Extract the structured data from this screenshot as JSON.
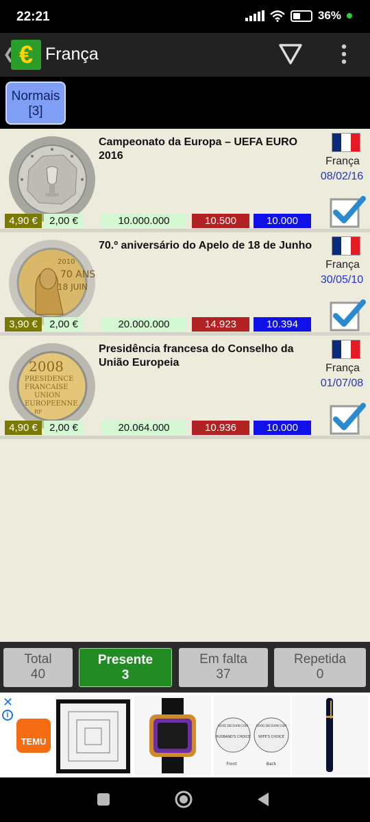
{
  "status": {
    "time": "22:21",
    "battery": "36%"
  },
  "appbar": {
    "title": "França",
    "logo_symbol": "€",
    "back_icon": "chevron-left-icon"
  },
  "tabs": [
    {
      "label": "Normais",
      "count": "[3]"
    }
  ],
  "coins": [
    {
      "title": "Campeonato da Europa – UEFA EURO 2016",
      "country": "França",
      "date": "08/02/16",
      "value": "4,90 €",
      "face": "2,00 €",
      "mintage": "10.000.000",
      "stat_red": "10.500",
      "stat_blue": "10.000",
      "checked": true
    },
    {
      "title": "70.º aniversário do Apelo de 18 de Junho",
      "country": "França",
      "date": "30/05/10",
      "value": "3,90 €",
      "face": "2,00 €",
      "mintage": "20.000.000",
      "stat_red": "14.923",
      "stat_blue": "10.394",
      "checked": true
    },
    {
      "title": "Presidência francesa do Conselho da União Europeia",
      "country": "França",
      "date": "01/07/08",
      "value": "4,90 €",
      "face": "2,00 €",
      "mintage": "20.064.000",
      "stat_red": "10.936",
      "stat_blue": "10.000",
      "checked": true
    }
  ],
  "coin_text": {
    "c2_year": "2010",
    "c2_a": "70 ANS",
    "c2_b": "18 JUIN",
    "c3_year": "2008",
    "c3_l1": "PRESIDENCE",
    "c3_l2": "FRANCAISE",
    "c3_l3": "UNION",
    "c3_l4": "EUROPEENNE",
    "c3_rf": "RF"
  },
  "buttons": [
    {
      "label": "Total",
      "count": "40"
    },
    {
      "label": "Presente",
      "count": "3"
    },
    {
      "label": "Em falta",
      "count": "37"
    },
    {
      "label": "Repetida",
      "count": "0"
    }
  ],
  "ad": {
    "brand": "TEMU",
    "close": "✕",
    "info": "i",
    "coin_label_1": "GOOD DECISION COIN",
    "coin_sub_1": "HUSBAND'S CHOICE",
    "coin_label_2": "GOOD DECISION COIN",
    "coin_sub_2": "WIFE'S CHOICE",
    "front": "Front",
    "back": "Back"
  },
  "colors": {
    "value_badge": "#7a7a00",
    "face_badge": "#d4f7d4",
    "red_stat": "#b22222",
    "blue_stat": "#1010e8",
    "active_button": "#238b23",
    "date_text": "#2233cc"
  }
}
